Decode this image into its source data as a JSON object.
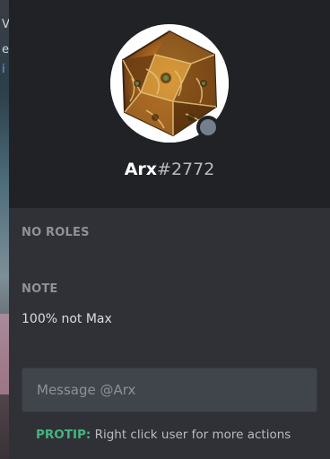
{
  "background": {
    "glyphs": [
      "V",
      "e",
      "i"
    ]
  },
  "profile": {
    "username": "Arx",
    "discriminator": "#2772",
    "status": "offline"
  },
  "sections": {
    "roles_label": "NO ROLES",
    "note_label": "NOTE",
    "note_value": "100% not Max"
  },
  "message": {
    "placeholder": "Message @Arx"
  },
  "protip": {
    "tag": "PROTIP:",
    "text": "Right click user for more actions"
  },
  "colors": {
    "header_bg": "#202225",
    "body_bg": "#2f3136",
    "status_offline": "#747f8d",
    "protip_green": "#43b581"
  }
}
